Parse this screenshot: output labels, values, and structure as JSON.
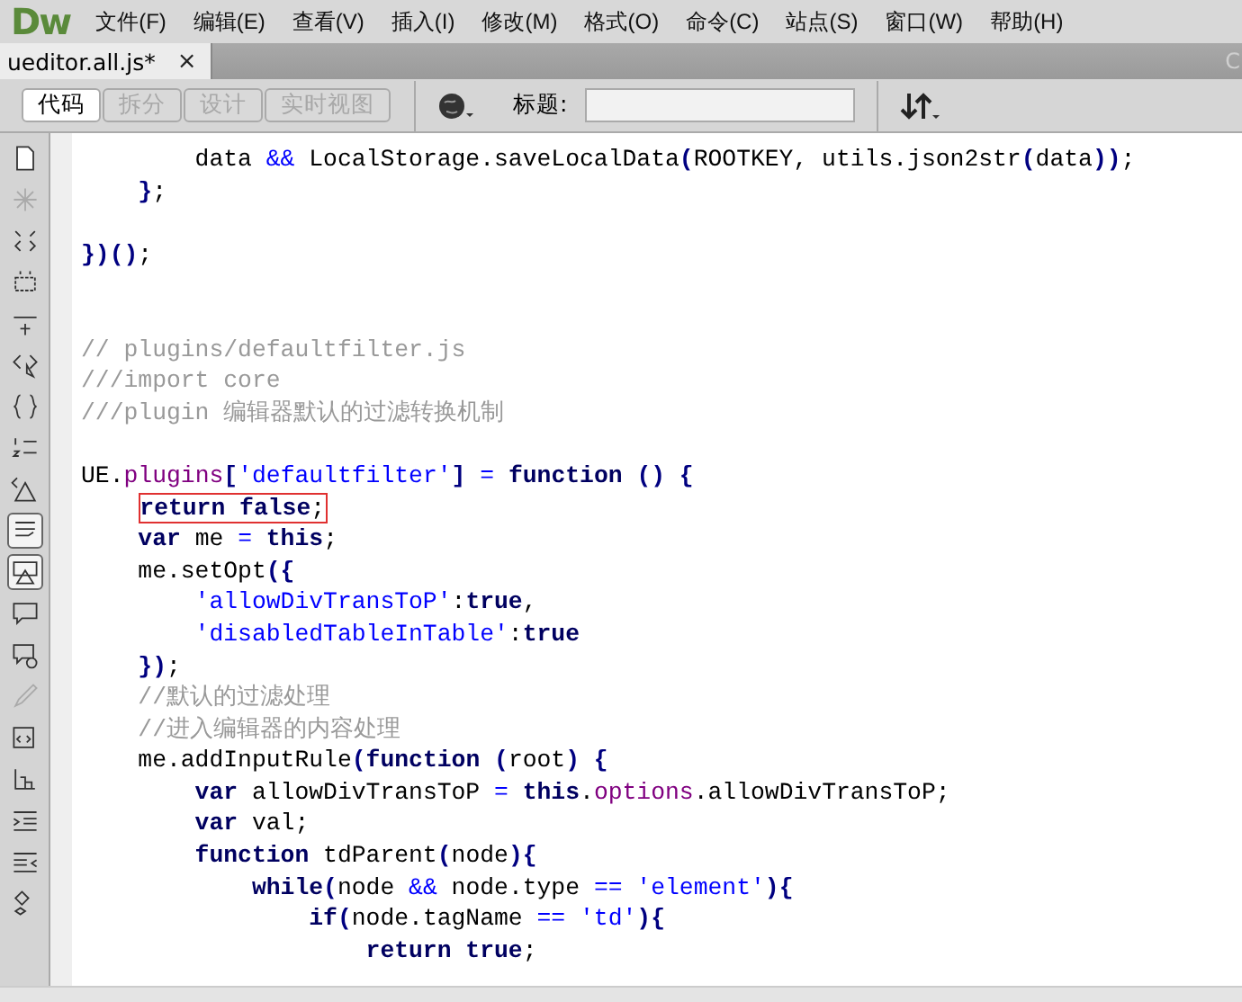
{
  "app": {
    "logo": "Dw"
  },
  "menu": [
    "文件(F)",
    "编辑(E)",
    "查看(V)",
    "插入(I)",
    "修改(M)",
    "格式(O)",
    "命令(C)",
    "站点(S)",
    "窗口(W)",
    "帮助(H)"
  ],
  "document_tab": {
    "title": "ueditor.all.js*",
    "close": "×",
    "path": "C"
  },
  "view_buttons": [
    {
      "label": "代码",
      "selected": true,
      "disabled": false
    },
    {
      "label": "拆分",
      "selected": false,
      "disabled": true
    },
    {
      "label": "设计",
      "selected": false,
      "disabled": true
    },
    {
      "label": "实时视图",
      "selected": false,
      "disabled": true
    }
  ],
  "title_field": {
    "label": "标题:"
  },
  "code_tools": [
    {
      "kind": "file",
      "selected": false,
      "disabled": false
    },
    {
      "kind": "star",
      "selected": false,
      "disabled": true
    },
    {
      "kind": "collapse",
      "selected": false,
      "disabled": false
    },
    {
      "kind": "collapse-box",
      "selected": false,
      "disabled": false
    },
    {
      "kind": "expand",
      "selected": false,
      "disabled": false
    },
    {
      "kind": "tag-pointer",
      "selected": false,
      "disabled": false
    },
    {
      "kind": "braces",
      "selected": false,
      "disabled": false
    },
    {
      "kind": "numbers",
      "selected": false,
      "disabled": false
    },
    {
      "kind": "warning-tag",
      "selected": false,
      "disabled": false
    },
    {
      "kind": "wrap",
      "selected": true,
      "disabled": false
    },
    {
      "kind": "info",
      "selected": true,
      "disabled": false
    },
    {
      "kind": "comment",
      "selected": false,
      "disabled": false
    },
    {
      "kind": "uncomment",
      "selected": false,
      "disabled": false
    },
    {
      "kind": "brush",
      "selected": false,
      "disabled": true
    },
    {
      "kind": "snippet",
      "selected": false,
      "disabled": false
    },
    {
      "kind": "chart",
      "selected": false,
      "disabled": false
    },
    {
      "kind": "indent",
      "selected": false,
      "disabled": false
    },
    {
      "kind": "outdent",
      "selected": false,
      "disabled": false
    },
    {
      "kind": "format",
      "selected": false,
      "disabled": false
    }
  ],
  "code_lines": [
    {
      "tokens": [
        {
          "kind": "plain",
          "text": "        data "
        },
        {
          "kind": "operator",
          "text": "&&"
        },
        {
          "kind": "plain",
          "text": " LocalStorage.saveLocalData"
        },
        {
          "kind": "punct",
          "text": "("
        },
        {
          "kind": "plain",
          "text": "ROOTKEY, utils.json2str"
        },
        {
          "kind": "punct",
          "text": "("
        },
        {
          "kind": "plain",
          "text": "data"
        },
        {
          "kind": "punct",
          "text": "))"
        },
        {
          "kind": "plain",
          "text": ";"
        }
      ]
    },
    {
      "tokens": [
        {
          "kind": "punct",
          "text": "    }"
        },
        {
          "kind": "plain",
          "text": ";"
        }
      ]
    },
    {
      "kind": "blank"
    },
    {
      "tokens": [
        {
          "kind": "punct",
          "text": "})()"
        },
        {
          "kind": "plain",
          "text": ";"
        }
      ]
    },
    {
      "kind": "blank"
    },
    {
      "kind": "blank"
    },
    {
      "tokens": [
        {
          "kind": "comment",
          "text": "// plugins/defaultfilter.js"
        }
      ]
    },
    {
      "tokens": [
        {
          "kind": "comment",
          "text": "///import core"
        }
      ]
    },
    {
      "tokens": [
        {
          "kind": "comment",
          "text": "///plugin 编辑器默认的过滤转换机制"
        }
      ]
    },
    {
      "kind": "blank"
    },
    {
      "tokens": [
        {
          "kind": "plain",
          "text": "UE."
        },
        {
          "kind": "property",
          "text": "plugins"
        },
        {
          "kind": "punct",
          "text": "["
        },
        {
          "kind": "string",
          "text": "'defaultfilter'"
        },
        {
          "kind": "punct",
          "text": "]"
        },
        {
          "kind": "operator",
          "text": " = "
        },
        {
          "kind": "keyword",
          "text": "function"
        },
        {
          "kind": "punct",
          "text": " () {"
        }
      ]
    },
    {
      "highlighted": true,
      "tokens": [
        {
          "kind": "keyword",
          "text": "    return false"
        },
        {
          "kind": "plain",
          "text": ";"
        }
      ]
    },
    {
      "tokens": [
        {
          "kind": "keyword",
          "text": "    var"
        },
        {
          "kind": "plain",
          "text": " me "
        },
        {
          "kind": "operator",
          "text": "="
        },
        {
          "kind": "keyword",
          "text": " this"
        },
        {
          "kind": "plain",
          "text": ";"
        }
      ]
    },
    {
      "tokens": [
        {
          "kind": "plain",
          "text": "    me.setOpt"
        },
        {
          "kind": "punct",
          "text": "({"
        }
      ]
    },
    {
      "tokens": [
        {
          "kind": "string",
          "text": "        'allowDivTransToP'"
        },
        {
          "kind": "plain",
          "text": ":"
        },
        {
          "kind": "keyword",
          "text": "true"
        },
        {
          "kind": "plain",
          "text": ","
        }
      ]
    },
    {
      "tokens": [
        {
          "kind": "string",
          "text": "        'disabledTableInTable'"
        },
        {
          "kind": "plain",
          "text": ":"
        },
        {
          "kind": "keyword",
          "text": "true"
        }
      ]
    },
    {
      "tokens": [
        {
          "kind": "punct",
          "text": "    })"
        },
        {
          "kind": "plain",
          "text": ";"
        }
      ]
    },
    {
      "tokens": [
        {
          "kind": "comment",
          "text": "    //默认的过滤处理"
        }
      ]
    },
    {
      "tokens": [
        {
          "kind": "comment",
          "text": "    //进入编辑器的内容处理"
        }
      ]
    },
    {
      "tokens": [
        {
          "kind": "plain",
          "text": "    me.addInputRule"
        },
        {
          "kind": "punct",
          "text": "("
        },
        {
          "kind": "keyword",
          "text": "function"
        },
        {
          "kind": "punct",
          "text": " ("
        },
        {
          "kind": "plain",
          "text": "root"
        },
        {
          "kind": "punct",
          "text": ") {"
        }
      ]
    },
    {
      "tokens": [
        {
          "kind": "keyword",
          "text": "        var"
        },
        {
          "kind": "plain",
          "text": " allowDivTransToP "
        },
        {
          "kind": "operator",
          "text": "="
        },
        {
          "kind": "keyword",
          "text": " this"
        },
        {
          "kind": "plain",
          "text": "."
        },
        {
          "kind": "property",
          "text": "options"
        },
        {
          "kind": "plain",
          "text": ".allowDivTransToP;"
        }
      ]
    },
    {
      "tokens": [
        {
          "kind": "keyword",
          "text": "        var"
        },
        {
          "kind": "plain",
          "text": " val;"
        }
      ]
    },
    {
      "tokens": [
        {
          "kind": "keyword",
          "text": "        function"
        },
        {
          "kind": "plain",
          "text": " tdParent"
        },
        {
          "kind": "punct",
          "text": "("
        },
        {
          "kind": "plain",
          "text": "node"
        },
        {
          "kind": "punct",
          "text": "){"
        }
      ]
    },
    {
      "tokens": [
        {
          "kind": "keyword",
          "text": "            while"
        },
        {
          "kind": "punct",
          "text": "("
        },
        {
          "kind": "plain",
          "text": "node "
        },
        {
          "kind": "operator",
          "text": "&&"
        },
        {
          "kind": "plain",
          "text": " node.type "
        },
        {
          "kind": "operator",
          "text": "=="
        },
        {
          "kind": "string",
          "text": " 'element'"
        },
        {
          "kind": "punct",
          "text": "){"
        }
      ]
    },
    {
      "tokens": [
        {
          "kind": "keyword",
          "text": "                if"
        },
        {
          "kind": "punct",
          "text": "("
        },
        {
          "kind": "plain",
          "text": "node.tagName "
        },
        {
          "kind": "operator",
          "text": "=="
        },
        {
          "kind": "string",
          "text": " 'td'"
        },
        {
          "kind": "punct",
          "text": "){"
        }
      ]
    },
    {
      "tokens": [
        {
          "kind": "keyword",
          "text": "                    return true"
        },
        {
          "kind": "plain",
          "text": ";"
        }
      ]
    }
  ]
}
